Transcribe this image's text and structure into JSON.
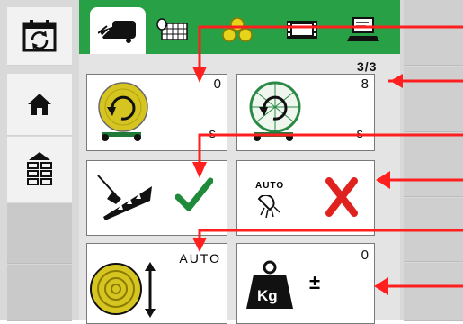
{
  "status": {
    "page_indicator": "3/3"
  },
  "tiles": {
    "rotation_left": {
      "value": "0",
      "unit": "s"
    },
    "rotation_right": {
      "value": "8",
      "unit": "s"
    },
    "knife": {
      "state": "enabled"
    },
    "auto_light": {
      "label": "AUTO",
      "state": "disabled"
    },
    "bale_diameter": {
      "label": "AUTO"
    },
    "weight": {
      "value": "0",
      "label": "Kg",
      "symbol": "±"
    }
  },
  "colors": {
    "accent_green": "#28a045",
    "check_green": "#1f8a3a",
    "cross_red": "#e0221f",
    "arrow_red": "#ff1f1f",
    "coil_yellow": "#d6c520"
  }
}
